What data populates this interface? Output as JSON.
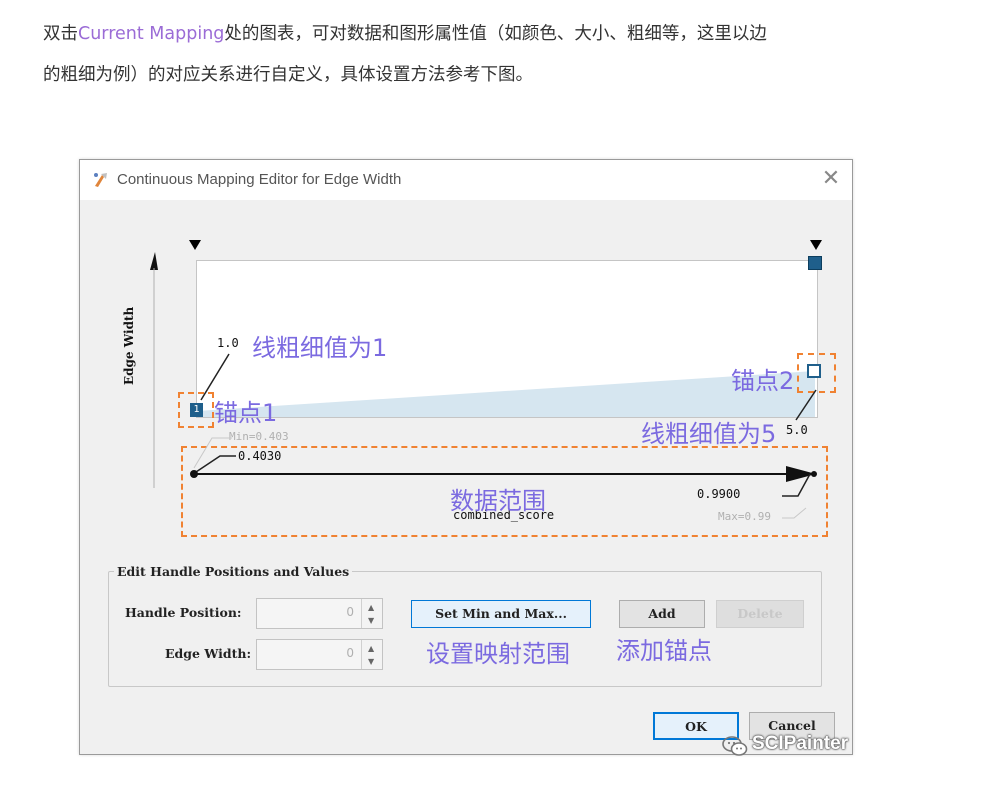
{
  "intro": {
    "line1_before": "双击",
    "line1_highlight": "Current Mapping",
    "line1_after": "处的图表，可对数据和图形属性值（如颜色、大小、粗细等，这里以边",
    "line2": "的粗细为例）的对应关系进行自定义，具体设置方法参考下图。"
  },
  "dialog": {
    "title": "Continuous Mapping Editor for Edge Width",
    "close_glyph": "✕",
    "y_axis_label": "Edge Width",
    "handle1": {
      "value_label": "1.0",
      "badge": "1"
    },
    "handle2": {
      "value_label": "5.0"
    },
    "range": {
      "min_label": "Min=0.403",
      "min_value": "0.4030",
      "max_value": "0.9900",
      "max_label": "Max=0.99",
      "attribute": "combined_score"
    },
    "edit_group": {
      "title": "Edit Handle Positions and Values",
      "handle_position_label": "Handle Position:",
      "handle_position_value": "0",
      "edge_width_label": "Edge Width:",
      "edge_width_value": "0",
      "set_min_max_label": "Set Min and Max...",
      "add_label": "Add",
      "delete_label": "Delete"
    },
    "ok_label": "OK",
    "cancel_label": "Cancel"
  },
  "annotations": {
    "line_width_1": "线粗细值为1",
    "anchor1": "锚点1",
    "anchor2": "锚点2",
    "line_width_5": "线粗细值为5",
    "data_range": "数据范围",
    "set_range": "设置映射范围",
    "add_anchor": "添加锚点"
  },
  "watermark": "SCIPainter",
  "colors": {
    "highlight_purple": "#9b6cd6",
    "annotation_blue": "#7b6ae0",
    "dashed_orange": "#f08232",
    "handle_blue": "#1f5f8b",
    "area_fill": "#d6e6f0"
  }
}
